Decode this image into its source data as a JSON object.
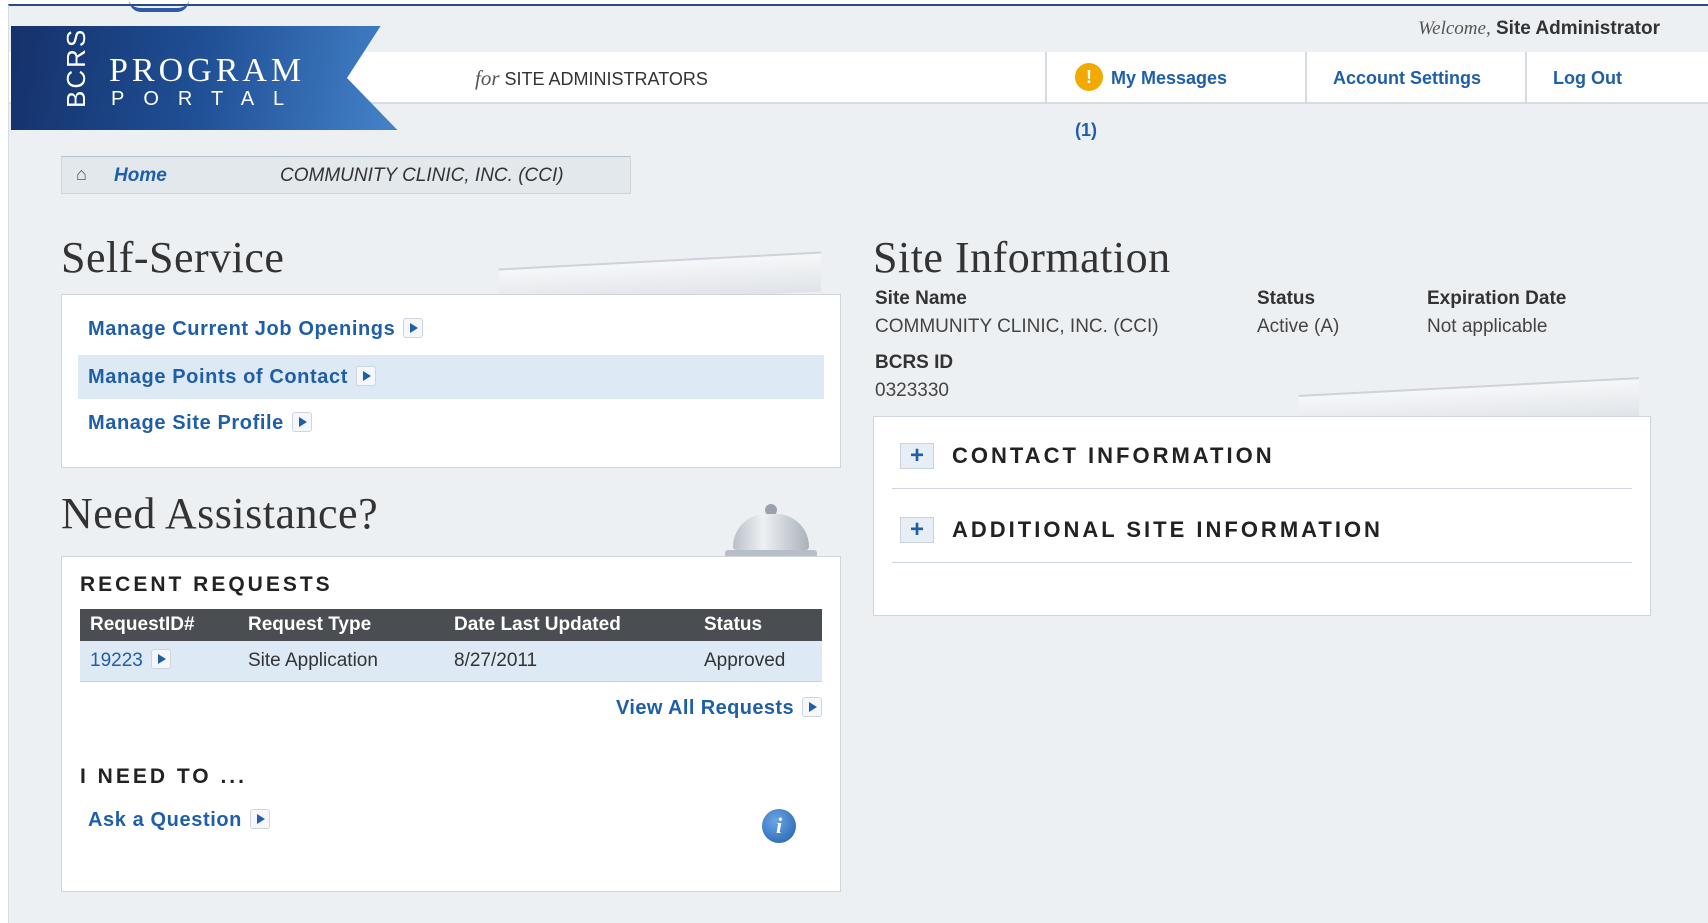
{
  "header": {
    "welcome_prefix": "Welcome,",
    "welcome_name": "Site Administrator",
    "logo_bcrs": "BCRS",
    "logo_program": "PROGRAM",
    "logo_portal": "PORTAL",
    "tagline_for": "for",
    "tagline_text": "SITE ADMINISTRATORS",
    "nav": {
      "messages": "My Messages (1)",
      "account": "Account Settings",
      "logout": "Log Out"
    },
    "message_badge": "!"
  },
  "breadcrumb": {
    "home": "Home",
    "current": "COMMUNITY CLINIC, INC. (CCI)"
  },
  "self_service": {
    "title": "Self-Service",
    "links": [
      {
        "label": "Manage Current Job Openings"
      },
      {
        "label": "Manage Points of Contact"
      },
      {
        "label": "Manage Site Profile"
      }
    ]
  },
  "assistance": {
    "title": "Need Assistance?",
    "recent_heading": "RECENT REQUESTS",
    "columns": [
      "RequestID#",
      "Request Type",
      "Date Last Updated",
      "Status"
    ],
    "rows": [
      {
        "id": "19223",
        "type": "Site Application",
        "date": "8/27/2011",
        "status": "Approved"
      }
    ],
    "view_all": "View All Requests",
    "need_to_heading": "I NEED TO ...",
    "ask_question": "Ask a Question",
    "info_icon": "i"
  },
  "site_info": {
    "title": "Site Information",
    "site_name_label": "Site Name",
    "site_name": "COMMUNITY CLINIC, INC. (CCI)",
    "status_label": "Status",
    "status": "Active (A)",
    "expiration_label": "Expiration Date",
    "expiration": "Not applicable",
    "bcrs_id_label": "BCRS ID",
    "bcrs_id": "0323330",
    "sections": [
      {
        "label": "CONTACT INFORMATION"
      },
      {
        "label": "ADDITIONAL SITE INFORMATION"
      }
    ]
  },
  "colors": {
    "link": "#1f5ea8",
    "brand_dark": "#15316a",
    "highlight": "#dde9f5",
    "badge": "#f2a900"
  }
}
